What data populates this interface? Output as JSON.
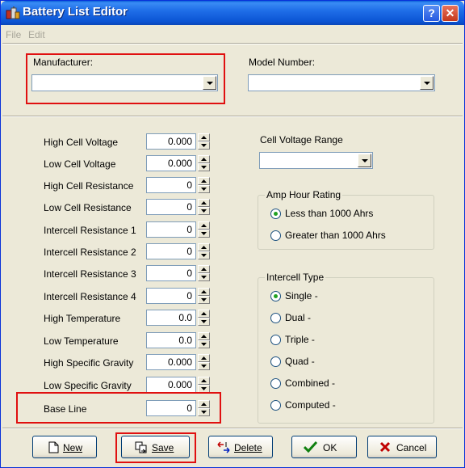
{
  "window": {
    "title": "Battery List Editor"
  },
  "title_buttons": {
    "help": "?",
    "close": "✕"
  },
  "menu": [
    "File",
    "Edit"
  ],
  "manufacturer": {
    "label": "Manufacturer:",
    "value": ""
  },
  "model": {
    "label": "Model Number:",
    "value": ""
  },
  "fields": [
    {
      "label": "High Cell Voltage",
      "value": "0.000"
    },
    {
      "label": "Low Cell Voltage",
      "value": "0.000"
    },
    {
      "label": "High Cell Resistance",
      "value": "0"
    },
    {
      "label": "Low Cell Resistance",
      "value": "0"
    },
    {
      "label": "Intercell Resistance 1",
      "value": "0"
    },
    {
      "label": "Intercell Resistance 2",
      "value": "0"
    },
    {
      "label": "Intercell Resistance 3",
      "value": "0"
    },
    {
      "label": "Intercell Resistance 4",
      "value": "0"
    },
    {
      "label": "High Temperature",
      "value": "0.0"
    },
    {
      "label": "Low Temperature",
      "value": "0.0"
    },
    {
      "label": "High Specific Gravity",
      "value": "0.000"
    },
    {
      "label": "Low Specific Gravity",
      "value": "0.000"
    },
    {
      "label": "Base Line",
      "value": "0"
    }
  ],
  "cell_voltage_range": {
    "label": "Cell Voltage Range",
    "value": ""
  },
  "amp_hour": {
    "title": "Amp Hour Rating",
    "options": [
      "Less than 1000 Ahrs",
      "Greater than 1000 Ahrs"
    ],
    "selected": 0
  },
  "intercell_type": {
    "title": "Intercell Type",
    "options": [
      "Single  -",
      "Dual  -",
      "Triple  -",
      "Quad  -",
      "Combined  -",
      "Computed  -"
    ],
    "selected": 0
  },
  "buttons": {
    "new": "New",
    "save": "Save",
    "delete": "Delete",
    "ok": "OK",
    "cancel": "Cancel"
  },
  "colors": {
    "title_bar": "#0b54d4",
    "window_bg": "#ece9d8",
    "highlight": "#e01010"
  }
}
